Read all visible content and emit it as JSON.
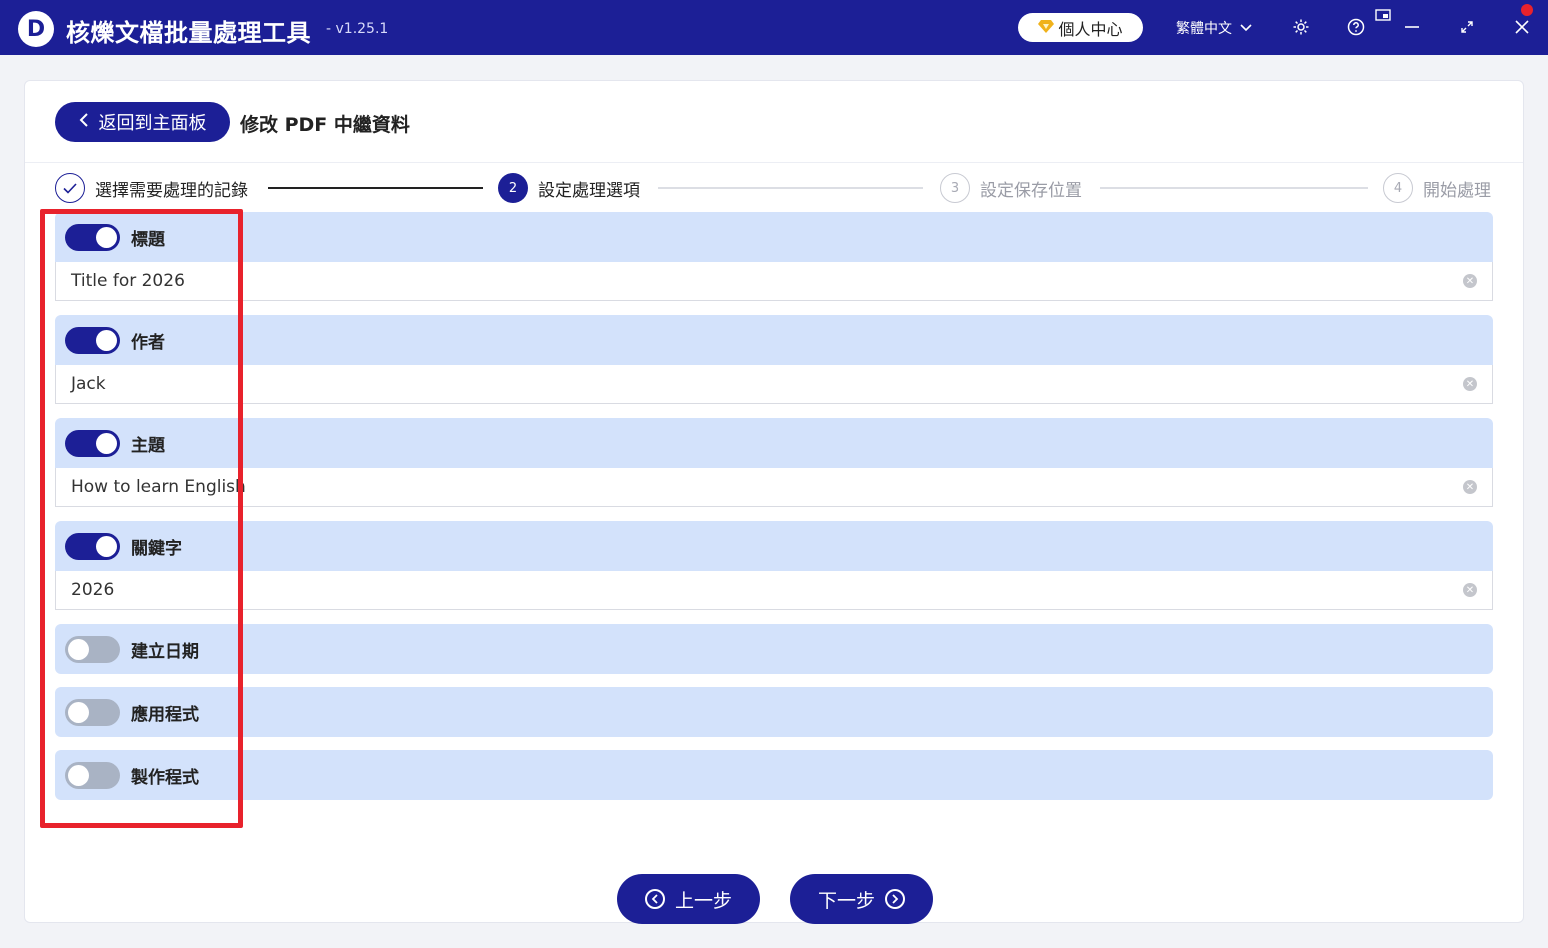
{
  "app": {
    "logo_letter": "D",
    "title": "核爍文檔批量處理工具",
    "version": "- v1.25.1",
    "user_center": "個人中心",
    "language": "繁體中文"
  },
  "header": {
    "back_label": "返回到主面板",
    "page_title": "修改 PDF 中繼資料"
  },
  "steps": [
    {
      "number": "",
      "label": "選擇需要處理的記錄",
      "status": "done"
    },
    {
      "number": "2",
      "label": "設定處理選項",
      "status": "active"
    },
    {
      "number": "3",
      "label": "設定保存位置",
      "status": "pending"
    },
    {
      "number": "4",
      "label": "開始處理",
      "status": "pending"
    }
  ],
  "options": [
    {
      "label": "標題",
      "enabled": true,
      "value": "Title for 2026"
    },
    {
      "label": "作者",
      "enabled": true,
      "value": "Jack"
    },
    {
      "label": "主題",
      "enabled": true,
      "value": "How to learn English"
    },
    {
      "label": "關鍵字",
      "enabled": true,
      "value": "2026"
    },
    {
      "label": "建立日期",
      "enabled": false
    },
    {
      "label": "應用程式",
      "enabled": false
    },
    {
      "label": "製作程式",
      "enabled": false
    }
  ],
  "footer": {
    "prev_label": "上一步",
    "next_label": "下一步"
  },
  "colors": {
    "brand": "#1c1f96",
    "section_bg": "#d3e2fb",
    "highlight": "#e8222c",
    "toggle_off": "#a9b3c4"
  }
}
